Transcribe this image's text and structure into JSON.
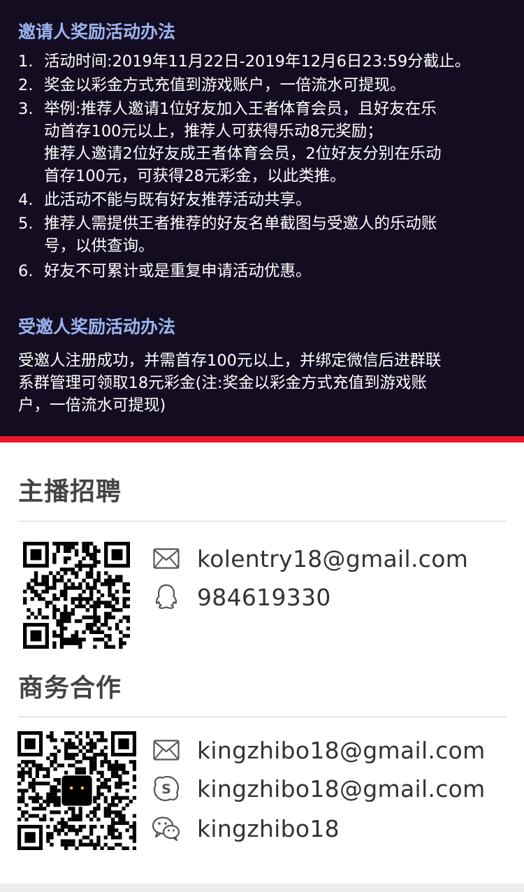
{
  "inviter": {
    "heading": "邀请人奖励活动办法",
    "rules": [
      {
        "num": "1.",
        "lines": [
          "活动时间:2019年11月22日-2019年12月6日23:59分截止。"
        ]
      },
      {
        "num": "2.",
        "lines": [
          "奖金以彩金方式充值到游戏账户，一倍流水可提现。"
        ]
      },
      {
        "num": "3.",
        "lines": [
          "举例:推荐人邀请1位好友加入王者体育会员，且好友在乐",
          "动首存100元以上，推荐人可获得乐动8元奖励；",
          "推荐人邀请2位好友成王者体育会员，2位好友分别在乐动",
          "首存100元，可获得28元彩金，以此类推。"
        ]
      },
      {
        "num": "4.",
        "lines": [
          "此活动不能与既有好友推荐活动共享。"
        ]
      },
      {
        "num": "5.",
        "lines": [
          "推荐人需提供王者推荐的好友名单截图与受邀人的乐动账",
          "号，以供查询。"
        ]
      },
      {
        "num": "6.",
        "lines": [
          "好友不可累计或是重复申请活动优惠。"
        ]
      }
    ]
  },
  "invitee": {
    "heading": "受邀人奖励活动办法",
    "lines": [
      "受邀人注册成功，并需首存100元以上，并绑定微信后进群联",
      "系群管理可领取18元彩金(注:奖金以彩金方式充值到游戏账",
      "户，一倍流水可提现)"
    ]
  },
  "recruit": {
    "title": "主播招聘",
    "email": "kolentry18@gmail.com",
    "qq": "984619330"
  },
  "business": {
    "title": "商务合作",
    "email": "kingzhibo18@gmail.com",
    "skype": "kingzhibo18@gmail.com",
    "wechat": "kingzhibo18"
  },
  "icons": [
    "mail-icon",
    "qq-icon",
    "skype-icon",
    "wechat-icon"
  ],
  "colors": {
    "panel_bg": "#140d22",
    "heading": "#9ab3ee",
    "accent_bar": "#e8182c",
    "section_title": "#444444",
    "icon": "#555555"
  }
}
